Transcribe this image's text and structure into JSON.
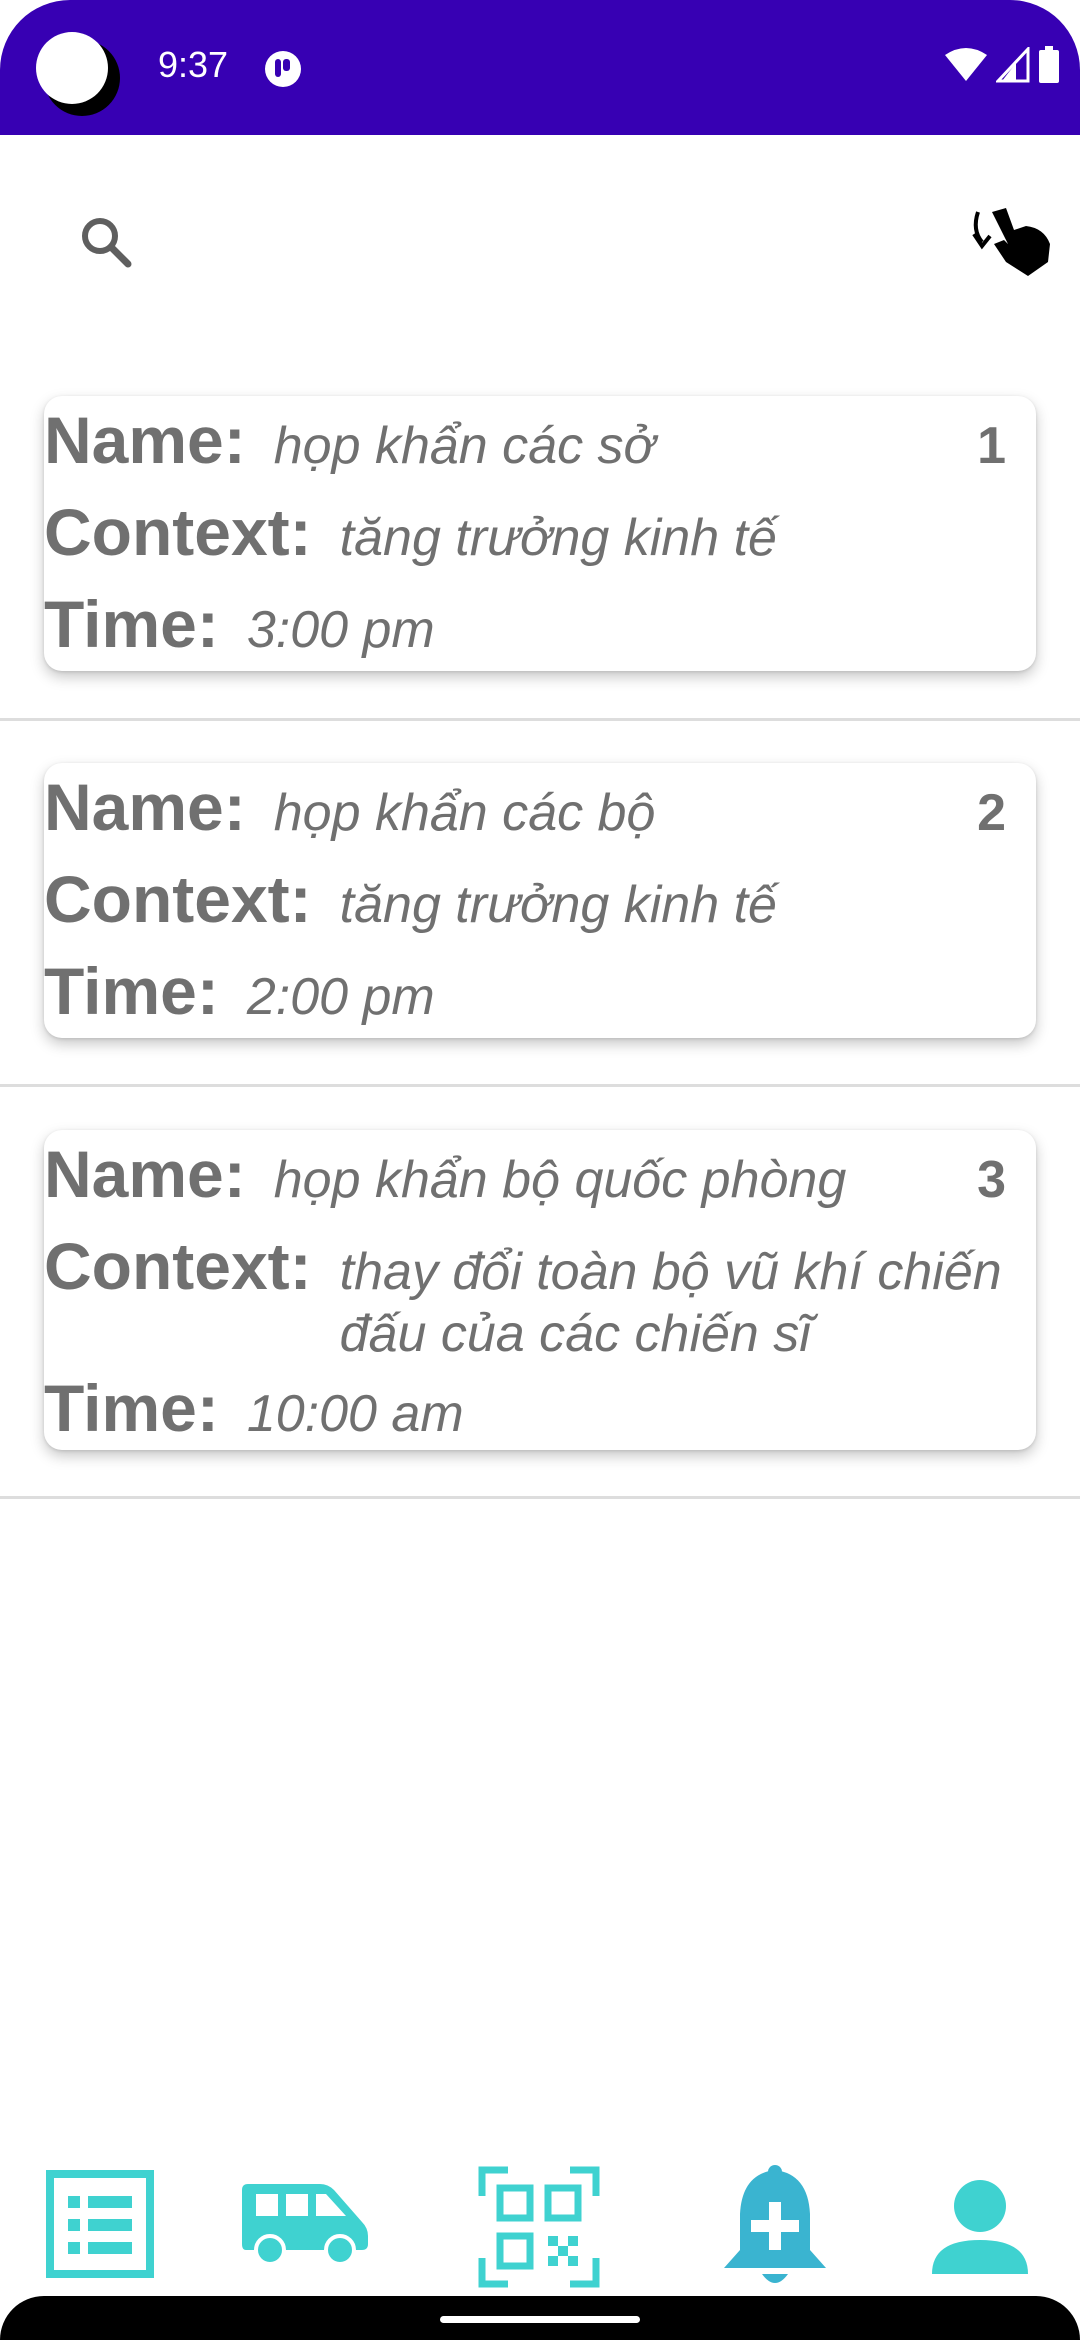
{
  "status_bar": {
    "time": "9:37",
    "bg_color": "#3700b3"
  },
  "toolbar": {
    "search_icon": "search-icon",
    "swipe_icon": "swipe-gesture-icon"
  },
  "meetings": [
    {
      "number": "1",
      "name_label": "Name:",
      "name": "họp khẩn các sở",
      "context_label": "Context:",
      "context": "tăng trưởng kinh tế",
      "time_label": "Time:",
      "time": "3:00 pm"
    },
    {
      "number": "2",
      "name_label": "Name:",
      "name": "họp khẩn các bộ",
      "context_label": "Context:",
      "context": "tăng trưởng kinh tế",
      "time_label": "Time:",
      "time": "2:00 pm"
    },
    {
      "number": "3",
      "name_label": "Name:",
      "name": "họp khẩn bộ quốc phòng",
      "context_label": "Context:",
      "context": "thay đổi toàn bộ vũ khí chiến đấu của các chiến sĩ",
      "time_label": "Time:",
      "time": "10:00 am"
    }
  ],
  "bottom_nav": {
    "items": [
      "list-icon",
      "van-icon",
      "qr-code-icon",
      "add-alarm-icon",
      "person-icon"
    ],
    "accent_color": "#3fd2d0",
    "alt_color": "#3ab4d0"
  }
}
